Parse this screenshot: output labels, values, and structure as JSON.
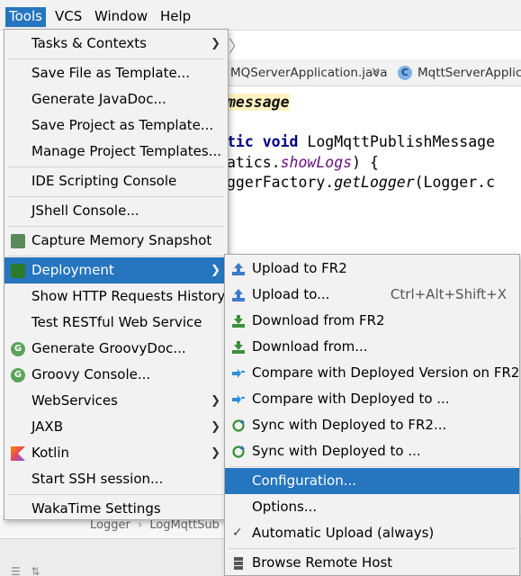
{
  "menubar": {
    "items": [
      "Tools",
      "VCS",
      "Window",
      "Help"
    ]
  },
  "editor": {
    "tabs": [
      "MQServerApplication.java",
      "MqttServerApplicat"
    ],
    "code": {
      "line1": "message",
      "line2_kw": "tic void",
      "line2_rest": " LogMqttPublishMessage",
      "line3_a": "atics.",
      "line3_b": "showLogs",
      "line3_c": ") {",
      "line4_a": "ggerFactory.",
      "line4_b": "getLogger",
      "line4_c": "(Logger.c"
    },
    "breadcrumb": [
      "Logger",
      "LogMqttSub"
    ]
  },
  "tools_menu": {
    "items": [
      {
        "label": "Tasks & Contexts",
        "submenu": true
      },
      {
        "label": "Save File as Template..."
      },
      {
        "label": "Generate JavaDoc..."
      },
      {
        "label": "Save Project as Template..."
      },
      {
        "label": "Manage Project Templates..."
      },
      {
        "label": "IDE Scripting Console"
      },
      {
        "label": "JShell Console..."
      },
      {
        "label": "Capture Memory Snapshot",
        "icon": "memory-snapshot-icon"
      },
      {
        "label": "Deployment",
        "icon": "deployment-icon",
        "submenu": true,
        "selected": true
      },
      {
        "label": "Show HTTP Requests History"
      },
      {
        "label": "Test RESTful Web Service"
      },
      {
        "label": "Generate GroovyDoc...",
        "icon": "groovy-icon"
      },
      {
        "label": "Groovy Console...",
        "icon": "groovy-icon"
      },
      {
        "label": "WebServices",
        "submenu": true
      },
      {
        "label": "JAXB",
        "submenu": true
      },
      {
        "label": "Kotlin",
        "icon": "kotlin-icon",
        "submenu": true
      },
      {
        "label": "Start SSH session..."
      },
      {
        "label": "WakaTime Settings"
      }
    ]
  },
  "deployment_menu": {
    "items": [
      {
        "label": "Upload to FR2",
        "icon": "upload-icon"
      },
      {
        "label": "Upload to...",
        "icon": "upload-icon",
        "shortcut": "Ctrl+Alt+Shift+X"
      },
      {
        "label": "Download from FR2",
        "icon": "download-icon"
      },
      {
        "label": "Download from...",
        "icon": "download-icon"
      },
      {
        "label": "Compare with Deployed Version on FR2",
        "icon": "compare-icon"
      },
      {
        "label": "Compare with Deployed to ...",
        "icon": "compare-icon"
      },
      {
        "label": "Sync with Deployed to FR2...",
        "icon": "sync-icon"
      },
      {
        "label": "Sync with Deployed to ...",
        "icon": "sync-icon"
      },
      {
        "label": "Configuration...",
        "selected": true
      },
      {
        "label": "Options..."
      },
      {
        "label": "Automatic Upload (always)",
        "icon": "check-icon"
      },
      {
        "label": "Browse Remote Host",
        "icon": "server-icon"
      }
    ]
  },
  "colors": {
    "selection": "#2675bf",
    "menu_bg": "#f2f2f2",
    "annotation_bg": "#fff4bf"
  }
}
